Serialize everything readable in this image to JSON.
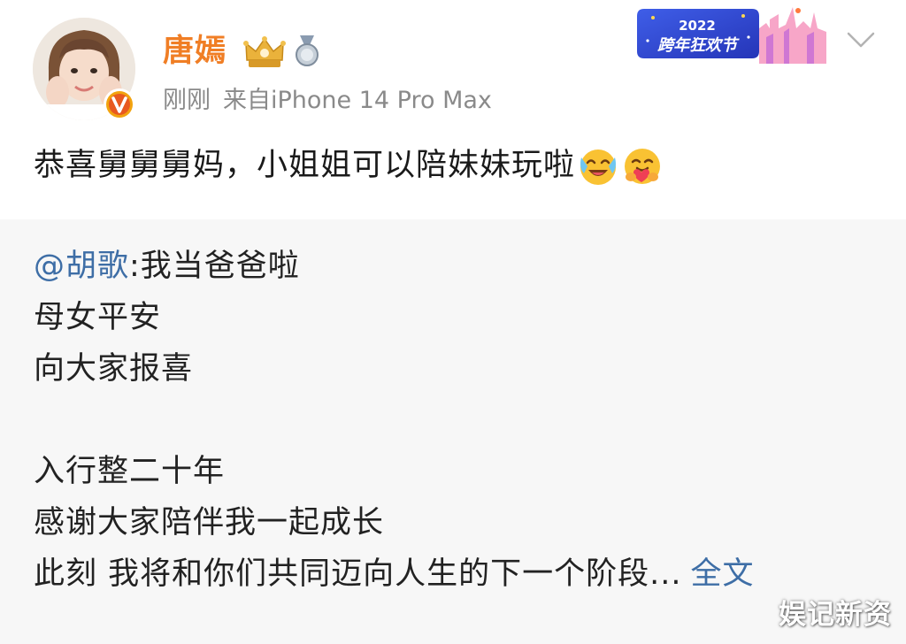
{
  "post": {
    "author": {
      "name": "唐嫣",
      "avatar": "avatar-photo",
      "verified_badge_icon": "verified-v-icon"
    },
    "meta": {
      "time": "刚刚",
      "source": "来自iPhone 14 Pro Max"
    },
    "badges": [
      "crown-badge-icon",
      "medal-badge-icon"
    ],
    "event_banner": {
      "year": "2022",
      "title": "跨年狂欢节"
    },
    "text": "恭喜舅舅舅妈，小姐姐可以陪妹妹玩啦",
    "emojis": [
      "laughing-crying-emoji",
      "hug-emoji"
    ]
  },
  "repost": {
    "mention": "@胡歌",
    "mention_text": ":我当爸爸啦",
    "lines": [
      "母女平安",
      "向大家报喜",
      "入行整二十年",
      "感谢大家陪伴我一起成长",
      "此刻 我将和你们共同迈向人生的下一个阶段..."
    ],
    "full_text_link": "全文"
  },
  "watermark": "娱记新资",
  "colors": {
    "username": "#f07e25",
    "meta": "#8a8a8a",
    "link": "#3e6ea6",
    "repost_bg": "#f7f7f7"
  }
}
